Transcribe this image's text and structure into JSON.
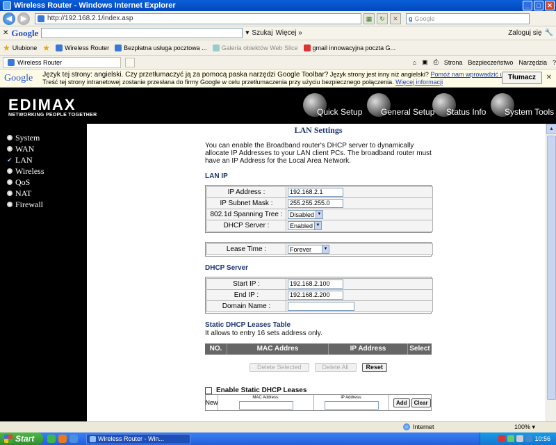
{
  "window": {
    "title": "Wireless Router - Windows Internet Explorer"
  },
  "addressbar": {
    "url": "http://192.168.2.1/index.asp",
    "search_placeholder": "Google"
  },
  "google_toolbar": {
    "logo": "Google",
    "search_label": "Szukaj",
    "more_label": "Więcej »",
    "signin_label": "Zaloguj się"
  },
  "favorites": {
    "label": "Ulubione",
    "items": [
      "Bezpłatna usługa pocztowa ...",
      "Galeria obiektów Web Slice",
      "gmail innowacyjna poczta G..."
    ],
    "active_tab": "Wireless Router"
  },
  "tools": {
    "strona": "Strona",
    "bezpieczenstwo": "Bezpieczeństwo",
    "narzedzia": "Narzędzia"
  },
  "translate_bar": {
    "logo": "Google",
    "question": "Język tej strony: angielski. Czy przetłumaczyć ją za pomocą paska narzędzi Google Toolbar?",
    "other_lang": "Język strony jest inny niż angielski?",
    "help_link": "Pomóż nam wprowadzić ulepszenia",
    "notice": "Treść tej strony intranetowej zostanie przesłana do firmy Google w celu przetłumaczenia przy użyciu bezpiecznego połączenia.",
    "more_link": "Więcej informacji",
    "button": "Tłumacz"
  },
  "header": {
    "logo": "EDIMAX",
    "tagline": "NETWORKING PEOPLE TOGETHER",
    "nav": [
      "Quick Setup",
      "General Setup",
      "Status Info",
      "System Tools"
    ]
  },
  "sidebar": {
    "items": [
      {
        "label": "System",
        "active": false
      },
      {
        "label": "WAN",
        "active": false
      },
      {
        "label": "LAN",
        "active": true
      },
      {
        "label": "Wireless",
        "active": false
      },
      {
        "label": "QoS",
        "active": false
      },
      {
        "label": "NAT",
        "active": false
      },
      {
        "label": "Firewall",
        "active": false
      }
    ]
  },
  "page": {
    "heading": "LAN Settings",
    "intro": "You can enable the Broadband router's DHCP server to dynamically allocate IP Addresses to your LAN client PCs. The broadband router must have an IP Address for the Local Area Network.",
    "lan_ip": {
      "title": "LAN IP",
      "ip_label": "IP Address :",
      "ip_value": "192.168.2.1",
      "mask_label": "IP Subnet Mask :",
      "mask_value": "255.255.255.0",
      "stp_label": "802.1d Spanning Tree :",
      "stp_value": "Disabled",
      "dhcp_label": "DHCP Server :",
      "dhcp_value": "Enabled"
    },
    "lease": {
      "label": "Lease Time :",
      "value": "Forever"
    },
    "dhcp_server": {
      "title": "DHCP Server",
      "start_label": "Start IP :",
      "start_value": "192.168.2.100",
      "end_label": "End IP :",
      "end_value": "192.168.2.200",
      "domain_label": "Domain Name :",
      "domain_value": ""
    },
    "static": {
      "title": "Static DHCP Leases Table",
      "note": "It allows to entry 16 sets address only.",
      "columns": [
        "NO.",
        "MAC Addres",
        "IP Address",
        "Select"
      ],
      "delete_selected": "Delete Selected",
      "delete_all": "Delete All",
      "reset": "Reset",
      "enable_label": "Enable Static DHCP Leases",
      "new_label": "New",
      "mac_label": "MAC Address:",
      "ip_label": "IP Address:",
      "add": "Add",
      "clear": "Clear"
    }
  },
  "statusbar": {
    "zone": "Internet",
    "zoom": "100%"
  },
  "taskbar": {
    "start": "Start",
    "task": "Wireless Router - Win...",
    "clock": "10:56"
  }
}
